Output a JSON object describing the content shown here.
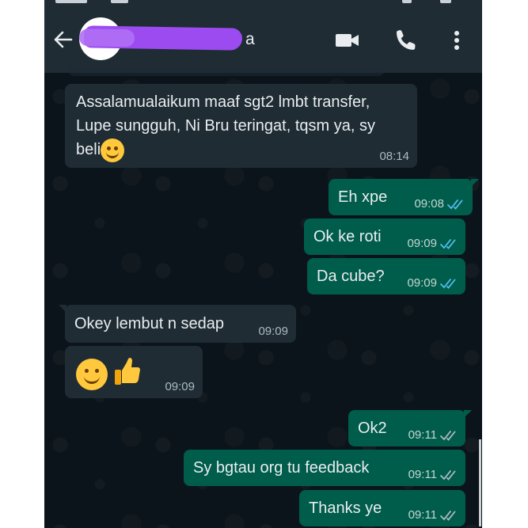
{
  "header": {
    "contact_name_visible_suffix": "a",
    "back_icon": "arrow-left-icon",
    "video_icon": "video-camera-icon",
    "call_icon": "phone-icon",
    "menu_icon": "more-vertical-icon"
  },
  "colors": {
    "header_bg": "#1f2c34",
    "chat_bg": "#0b141a",
    "incoming_bubble": "#1f2c34",
    "outgoing_bubble": "#005c4b",
    "read_tick": "#53bdeb",
    "delivered_tick": "#aebac1",
    "redaction": "#9b4bf0"
  },
  "messages": [
    {
      "direction": "in",
      "line1": "Assalamualaikum maaf sgt2 lmbt transfer,",
      "line2": "Lupe sungguh, Ni Bru teringat, tqsm ya, sy",
      "line3": "beli",
      "emoji": "smile",
      "time": "08:14"
    },
    {
      "direction": "out",
      "text": "Eh xpe",
      "time": "09:08",
      "status": "read"
    },
    {
      "direction": "out",
      "text": "Ok ke roti",
      "time": "09:09",
      "status": "read"
    },
    {
      "direction": "out",
      "text": "Da cube?",
      "time": "09:09",
      "status": "read"
    },
    {
      "direction": "in",
      "text": "Okey lembut n sedap",
      "time": "09:09"
    },
    {
      "direction": "in",
      "emoji": "smile thumbs-up",
      "time": "09:09"
    },
    {
      "direction": "out",
      "text": "Ok2",
      "time": "09:11",
      "status": "delivered"
    },
    {
      "direction": "out",
      "text": "Sy bgtau org tu feedback",
      "time": "09:11",
      "status": "delivered"
    },
    {
      "direction": "out",
      "text": "Thanks ye",
      "time": "09:11",
      "status": "delivered"
    }
  ]
}
